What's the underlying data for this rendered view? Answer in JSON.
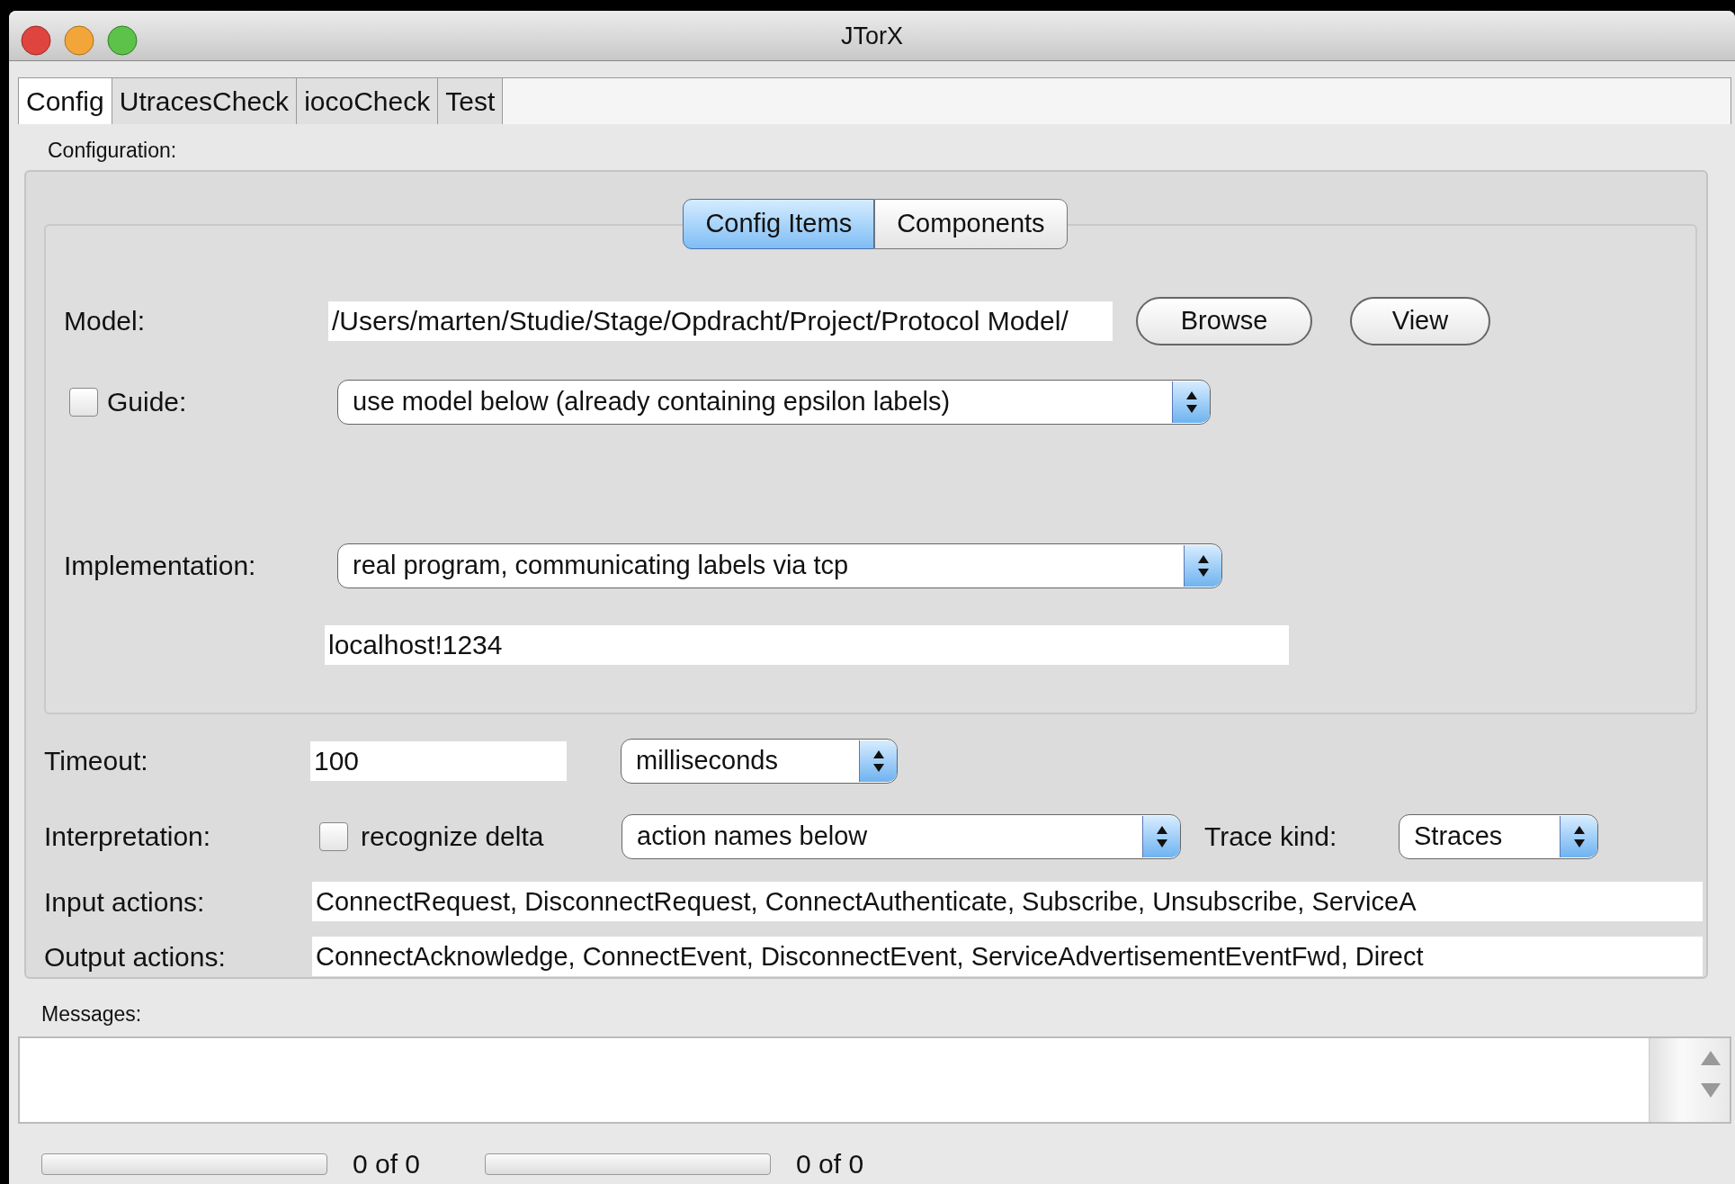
{
  "window": {
    "title": "JTorX"
  },
  "tabs": [
    {
      "label": "Config",
      "selected": true
    },
    {
      "label": "UtracesCheck",
      "selected": false
    },
    {
      "label": "iocoCheck",
      "selected": false
    },
    {
      "label": "Test",
      "selected": false
    }
  ],
  "config_label": "Configuration:",
  "segments": [
    {
      "label": "Config Items",
      "selected": true
    },
    {
      "label": "Components",
      "selected": false
    }
  ],
  "model": {
    "label": "Model:",
    "value": "/Users/marten/Studie/Stage/Opdracht/Project/Protocol Model/",
    "buttons": [
      "Browse",
      "View"
    ]
  },
  "guide": {
    "label": "Guide:",
    "checked": false,
    "select": "use model below (already containing epsilon labels)"
  },
  "implementation": {
    "label": "Implementation:",
    "select": "real program, communicating labels via tcp",
    "address": "localhost!1234"
  },
  "timeout": {
    "label": "Timeout:",
    "value": "100",
    "unit": "milliseconds"
  },
  "interpretation": {
    "label": "Interpretation:",
    "checkbox_label": "recognize delta",
    "checked": false,
    "select": "action names below",
    "trace_label": "Trace kind:",
    "trace_kind": "Straces"
  },
  "input_actions": {
    "label": "Input actions:",
    "value": "ConnectRequest, DisconnectRequest, ConnectAuthenticate, Subscribe, Unsubscribe, ServiceA"
  },
  "output_actions": {
    "label": "Output actions:",
    "value": "ConnectAcknowledge, ConnectEvent, DisconnectEvent, ServiceAdvertisementEventFwd, Direct"
  },
  "messages": {
    "label": "Messages:"
  },
  "progress": [
    {
      "level": 0,
      "reading": "0 of 0"
    },
    {
      "level": 0,
      "reading": "0 of 0"
    }
  ]
}
